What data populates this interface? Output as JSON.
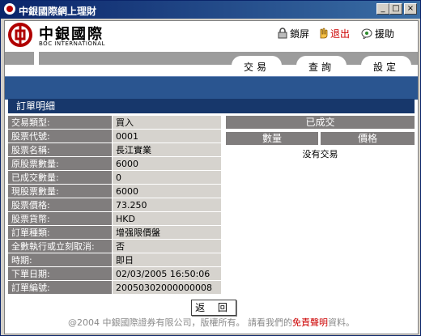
{
  "window": {
    "title": "中銀國際網上理財",
    "controls": {
      "minimize": "_",
      "maximize": "□",
      "close": "×"
    }
  },
  "brand": {
    "name": "中銀國際",
    "subtitle": "BOC INTERNATIONAL",
    "color": "#b00000"
  },
  "toolbar": {
    "lock_label": "鎖屏",
    "exit_label": "退出",
    "help_label": "援助"
  },
  "nav": {
    "tabs": [
      "交易",
      "查詢",
      "設定"
    ]
  },
  "colors": {
    "label_bg": "#807d7d",
    "value_bg": "#d6d3ce",
    "panel_title_bg": "#17376b",
    "band_blue": "#2a5590"
  },
  "panel": {
    "title": "訂單明細"
  },
  "order": {
    "rows": [
      {
        "label": "交易類型:",
        "value": "買入"
      },
      {
        "label": "股票代號:",
        "value": "0001"
      },
      {
        "label": "股票名稱:",
        "value": "長江實業"
      },
      {
        "label": "原股票數量:",
        "value": "6000"
      },
      {
        "label": "已成交數量:",
        "value": "0"
      },
      {
        "label": "現股票數量:",
        "value": "6000"
      },
      {
        "label": "股票價格:",
        "value": "73.250"
      },
      {
        "label": "股票貨幣:",
        "value": "HKD"
      },
      {
        "label": "訂單種類:",
        "value": "增强限價盤"
      },
      {
        "label": "全數執行或立刻取消:",
        "value": "否"
      },
      {
        "label": "時期:",
        "value": "即日"
      },
      {
        "label": "下單日期:",
        "value": "02/03/2005 16:50:06"
      },
      {
        "label": "訂單編號:",
        "value": "20050302000000008"
      }
    ]
  },
  "executed": {
    "header": "已成交",
    "columns": [
      "數量",
      "價格"
    ],
    "empty_text": "没有交易"
  },
  "back_button": "返 回",
  "footer": {
    "prefix": "@2004 中銀國際證券有限公司，版權所有。 請看我們的",
    "link": "免責聲明",
    "suffix": "資料。"
  }
}
